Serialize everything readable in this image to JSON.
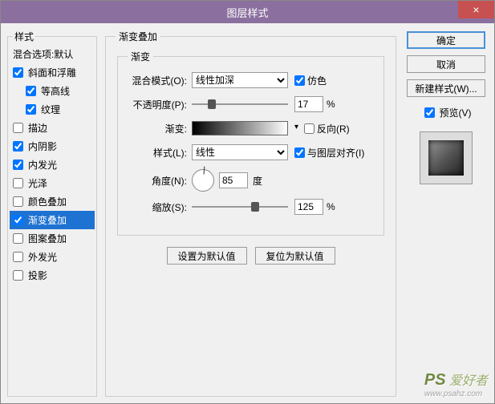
{
  "window": {
    "title": "图层样式"
  },
  "close": "×",
  "leftPanel": {
    "legend": "样式",
    "blendOptions": "混合选项:默认",
    "items": [
      {
        "label": "斜面和浮雕",
        "checked": true
      },
      {
        "label": "等高线",
        "checked": true,
        "indent": true
      },
      {
        "label": "纹理",
        "checked": true,
        "indent": true
      },
      {
        "label": "描边",
        "checked": false
      },
      {
        "label": "内阴影",
        "checked": true
      },
      {
        "label": "内发光",
        "checked": true
      },
      {
        "label": "光泽",
        "checked": false
      },
      {
        "label": "颜色叠加",
        "checked": false
      },
      {
        "label": "渐变叠加",
        "checked": true,
        "selected": true
      },
      {
        "label": "图案叠加",
        "checked": false
      },
      {
        "label": "外发光",
        "checked": false
      },
      {
        "label": "投影",
        "checked": false
      }
    ]
  },
  "center": {
    "legend": "渐变叠加",
    "innerLegend": "渐变",
    "blendMode": {
      "label": "混合模式(O):",
      "value": "线性加深"
    },
    "dither": {
      "label": "仿色",
      "checked": true
    },
    "opacity": {
      "label": "不透明度(P):",
      "value": "17",
      "unit": "%"
    },
    "gradient": {
      "label": "渐变:"
    },
    "reverse": {
      "label": "反向(R)",
      "checked": false
    },
    "style": {
      "label": "样式(L):",
      "value": "线性"
    },
    "align": {
      "label": "与图层对齐(I)",
      "checked": true
    },
    "angle": {
      "label": "角度(N):",
      "value": "85",
      "unit": "度"
    },
    "scale": {
      "label": "缩放(S):",
      "value": "125",
      "unit": "%"
    },
    "setDefault": "设置为默认值",
    "resetDefault": "复位为默认值"
  },
  "right": {
    "ok": "确定",
    "cancel": "取消",
    "newStyle": "新建样式(W)...",
    "preview": {
      "label": "预览(V)",
      "checked": true
    }
  },
  "watermark": "PS 爱好者"
}
